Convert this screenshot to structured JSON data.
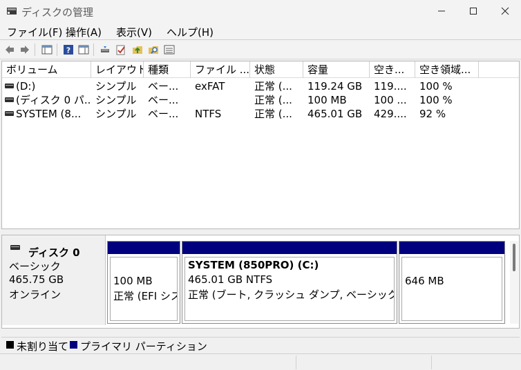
{
  "window": {
    "title": "ディスクの管理",
    "controls": {
      "minimize": "—",
      "maximize": "☐",
      "close": "✕"
    }
  },
  "menu": [
    "ファイル(F)",
    "操作(A)",
    "表示(V)",
    "ヘルプ(H)"
  ],
  "toolbar": {
    "icons": [
      "back-arrow-icon",
      "forward-arrow-icon",
      "console-tree-icon",
      "help-icon",
      "action-pane-icon",
      "connect-drive-icon",
      "check-properties-icon",
      "folder-up-icon",
      "search-folder-icon",
      "list-view-icon"
    ]
  },
  "volume_table": {
    "columns": [
      "ボリューム",
      "レイアウト",
      "種類",
      "ファイル ...",
      "状態",
      "容量",
      "空き...",
      "空き領域..."
    ],
    "rows": [
      [
        "(D:)",
        "シンプル",
        "ベー...",
        "exFAT",
        "正常 (...",
        "119.24 GB",
        "119....",
        "100 %"
      ],
      [
        "(ディスク 0 パ...",
        "シンプル",
        "ベー...",
        "",
        "正常 (...",
        "100 MB",
        "100 ...",
        "100 %"
      ],
      [
        "SYSTEM (8...",
        "シンプル",
        "ベー...",
        "NTFS",
        "正常 (...",
        "465.01 GB",
        "429....",
        "92 %"
      ]
    ]
  },
  "disk": {
    "name": "ディスク 0",
    "type": "ベーシック",
    "size": "465.75 GB",
    "status": "オンライン",
    "partitions": [
      {
        "title": "",
        "size": "100 MB",
        "status": "正常 (EFI シス"
      },
      {
        "title": "SYSTEM (850PRO)  (C:)",
        "size": "465.01 GB NTFS",
        "status": "正常 (ブート, クラッシュ ダンプ, ベーシック データ"
      },
      {
        "title": "",
        "size": "646 MB",
        "status": ""
      }
    ]
  },
  "legend": [
    {
      "label": "未割り当て",
      "color": "#000000"
    },
    {
      "label": "プライマリ パーティション",
      "color": "#00007f"
    }
  ],
  "colors": {
    "partition_band": "#00007f",
    "unallocated": "#000000"
  }
}
